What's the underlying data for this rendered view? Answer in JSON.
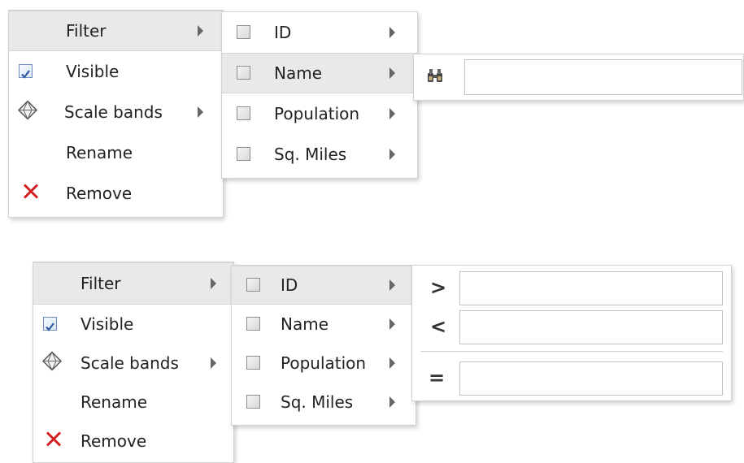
{
  "layer_menu": {
    "filter_label": "Filter",
    "visible_label": "Visible",
    "visible_checked": true,
    "scale_bands_label": "Scale bands",
    "rename_label": "Rename",
    "remove_label": "Remove"
  },
  "field_menu": {
    "fields": [
      "ID",
      "Name",
      "Population",
      "Sq. Miles"
    ]
  },
  "top_example": {
    "highlighted_field": "Name",
    "search_icon": "binoculars-icon",
    "search_value": ""
  },
  "bottom_example": {
    "highlighted_field": "ID",
    "operators": [
      {
        "symbol": ">",
        "value": ""
      },
      {
        "symbol": "<",
        "value": ""
      },
      {
        "symbol": "=",
        "value": ""
      }
    ]
  }
}
